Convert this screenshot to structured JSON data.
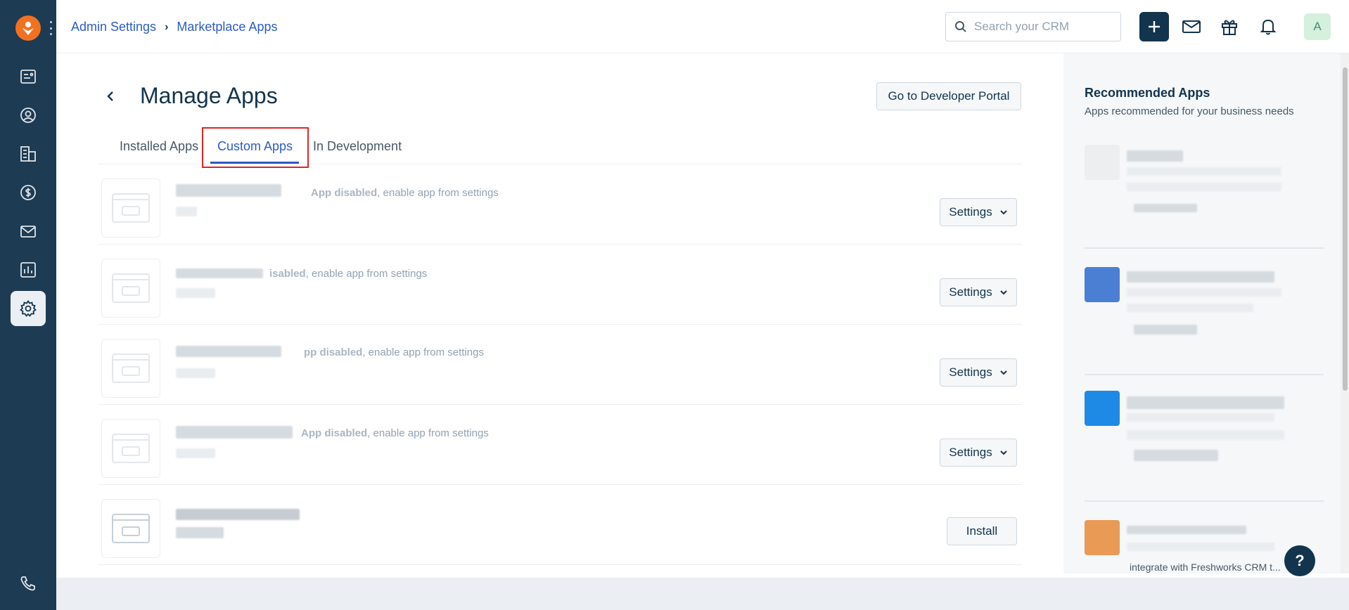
{
  "breadcrumb": {
    "root": "Admin Settings",
    "current": "Marketplace Apps"
  },
  "search": {
    "placeholder": "Search your CRM"
  },
  "user": {
    "avatar_letter": "A"
  },
  "page": {
    "title": "Manage Apps",
    "dev_portal_label": "Go to Developer Portal"
  },
  "tabs": [
    {
      "label": "Installed Apps",
      "active": false
    },
    {
      "label": "Custom Apps",
      "active": true
    },
    {
      "label": "In Development",
      "active": false
    }
  ],
  "apps": [
    {
      "status_bold": "App disabled",
      "status_rest": ", enable app from settings",
      "action": "Settings"
    },
    {
      "status_bold": "isabled",
      "status_rest": ", enable app from settings",
      "action": "Settings"
    },
    {
      "status_bold": "pp disabled",
      "status_rest": ", enable app from settings",
      "action": "Settings"
    },
    {
      "status_bold": "App disabled",
      "status_rest": ", enable app from settings",
      "action": "Settings"
    },
    {
      "status_bold": "",
      "status_rest": "",
      "action": "Install"
    }
  ],
  "recommended": {
    "title": "Recommended Apps",
    "subtitle": "Apps recommended for your business needs",
    "footer_text": "integrate with Freshworks CRM t..."
  },
  "help": {
    "label": "?"
  },
  "colors": {
    "sidebar": "#1d3b53",
    "accent": "#2c5cc5",
    "brand_orange": "#f27121",
    "highlight": "#e02424"
  },
  "icons": [
    "crm-logo-icon",
    "deals-board-icon",
    "contacts-icon",
    "accounts-icon",
    "deals-dollar-icon",
    "mail-icon",
    "reports-icon",
    "settings-gear-icon",
    "phone-icon",
    "search-icon",
    "plus-icon",
    "envelope-icon",
    "gift-icon",
    "bell-icon",
    "chevron-down-icon",
    "back-arrow-icon",
    "app-placeholder-icon"
  ]
}
